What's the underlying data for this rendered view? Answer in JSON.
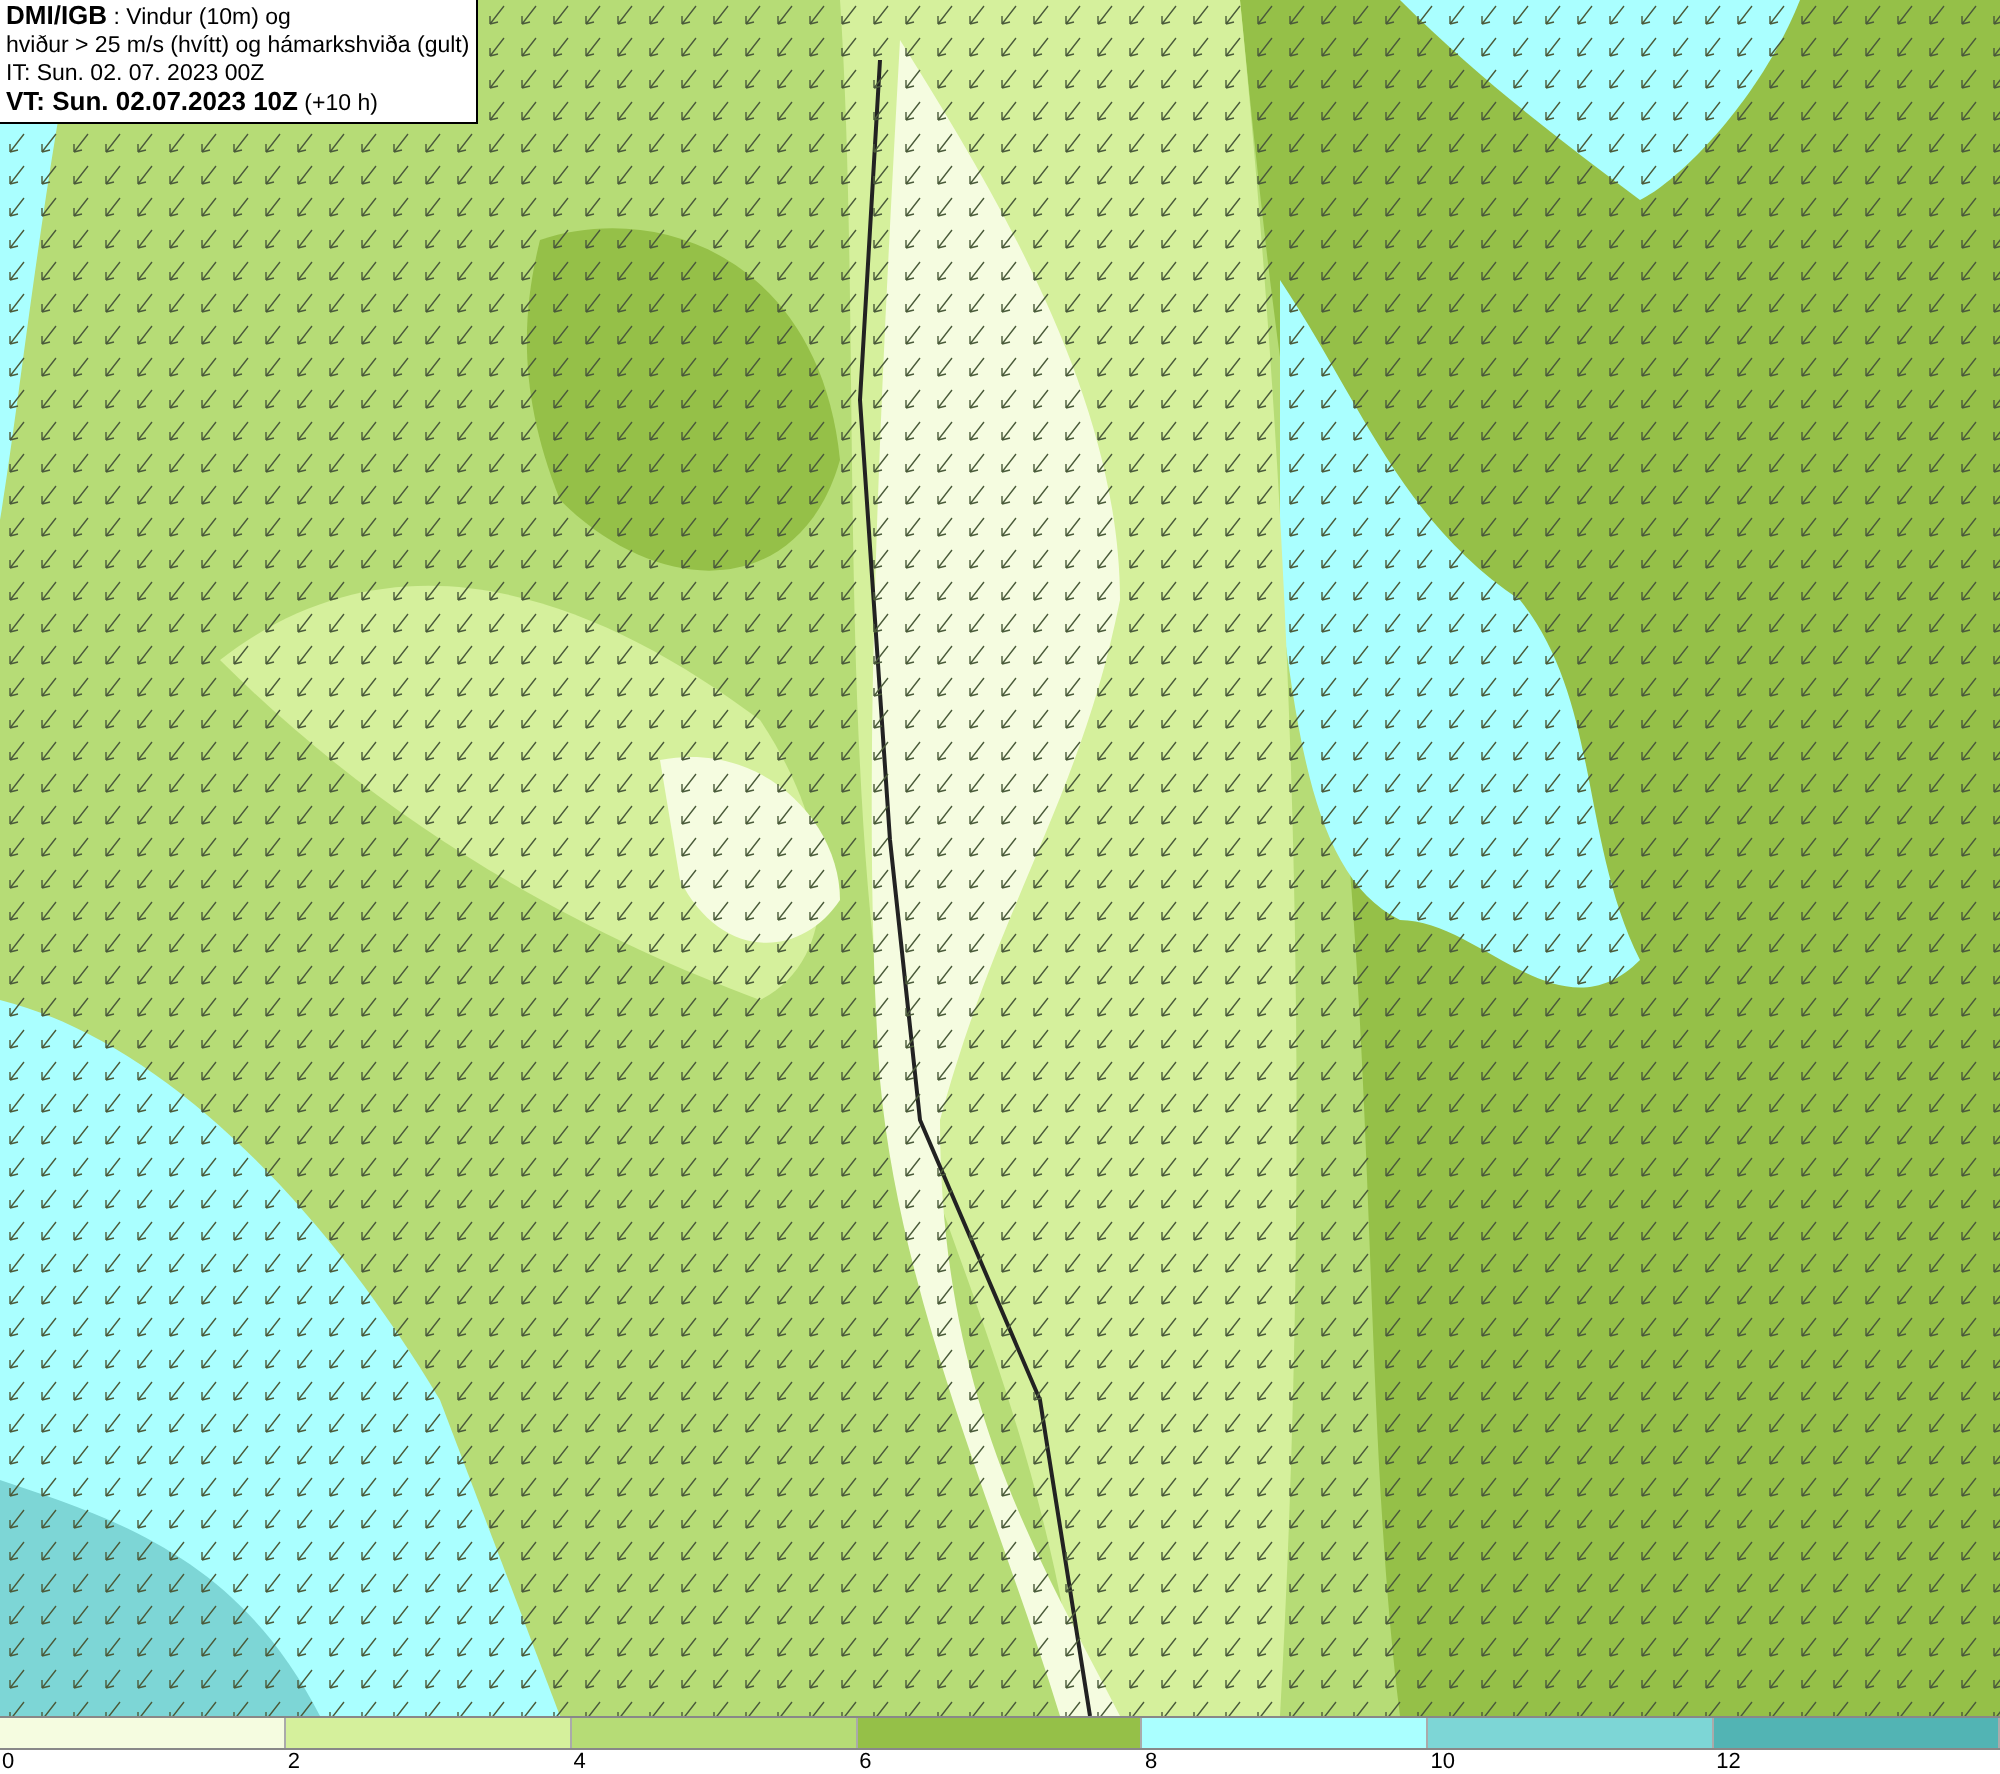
{
  "header": {
    "lines": [
      "**DMI/IGB** : Vindur (10m) og",
      "hviður > 25 m/s (hvítt) og hámarkshviða (gult)",
      "IT: Sun. 02. 07. 2023 00Z",
      "**VT: Sun. 02.07.2023 10Z** (+10 h)"
    ]
  },
  "legend": {
    "bins": [
      {
        "color": "#f5fce0"
      },
      {
        "color": "#d5f09c"
      },
      {
        "color": "#b6dc76"
      },
      {
        "color": "#95c048"
      },
      {
        "color": "#aaffff"
      },
      {
        "color": "#7dd6d6"
      },
      {
        "color": "#52b4b4"
      }
    ],
    "ticks": [
      "0",
      "2",
      "4",
      "6",
      "8",
      "10",
      "12"
    ]
  }
}
